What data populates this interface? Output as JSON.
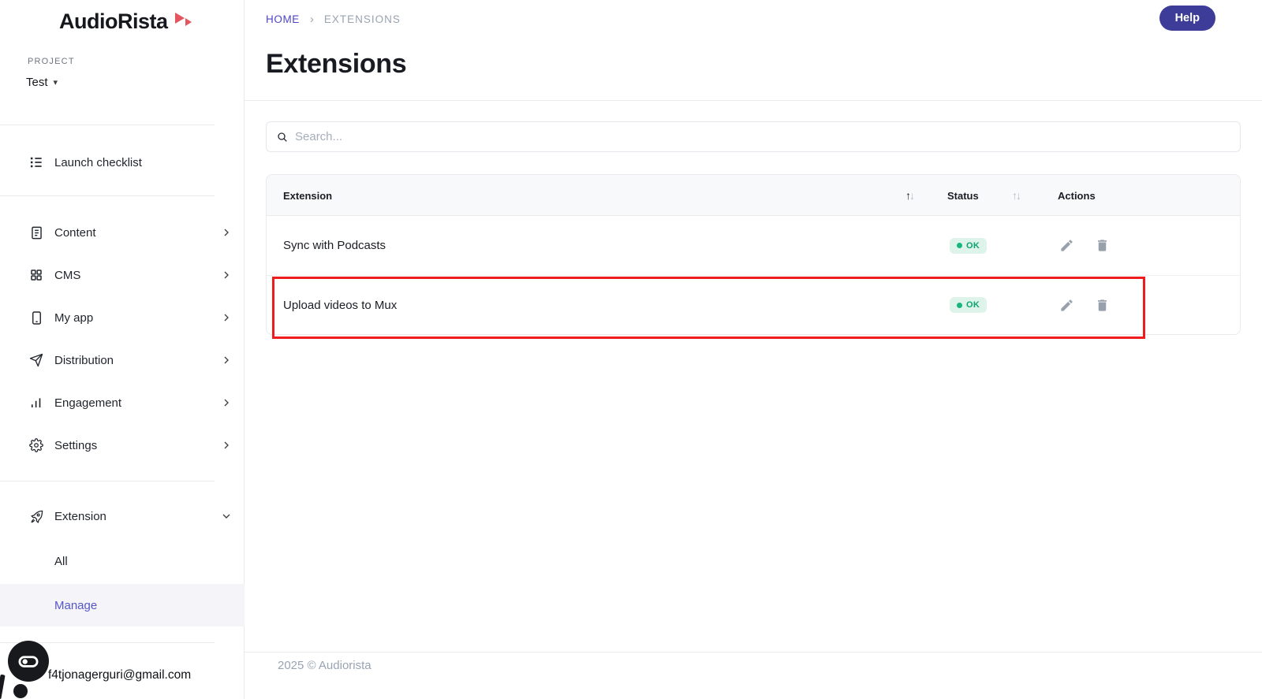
{
  "sidebar": {
    "logo_text": "AudioRista",
    "project_label": "PROJECT",
    "project_value": "Test",
    "launch_checklist": {
      "label": "Launch checklist"
    },
    "menu": [
      {
        "label": "Content",
        "icon": "document-icon"
      },
      {
        "label": "CMS",
        "icon": "grid-icon"
      },
      {
        "label": "My app",
        "icon": "smartphone-icon"
      },
      {
        "label": "Distribution",
        "icon": "send-icon"
      },
      {
        "label": "Engagement",
        "icon": "bar-chart-icon"
      },
      {
        "label": "Settings",
        "icon": "gear-icon"
      }
    ],
    "extension_group": {
      "label": "Extension",
      "children": [
        {
          "label": "All",
          "active": false
        },
        {
          "label": "Manage",
          "active": true
        }
      ]
    },
    "user_email": "f4tjonagerguri@gmail.com"
  },
  "header": {
    "breadcrumb": [
      "HOME",
      "EXTENSIONS"
    ],
    "help_label": "Help",
    "title": "Extensions"
  },
  "search": {
    "placeholder": "Search..."
  },
  "table": {
    "columns": [
      "Extension",
      "Status",
      "Actions"
    ],
    "rows": [
      {
        "name": "Sync with Podcasts",
        "status": "OK",
        "highlighted": false
      },
      {
        "name": "Upload videos to Mux",
        "status": "OK",
        "highlighted": true
      }
    ]
  },
  "footer": {
    "copyright": "2025 © Audiorista"
  },
  "icons": {
    "sort_up": "↑",
    "sort_down": "↓",
    "breadcrumb_separator": "›",
    "caret_down": "▾"
  },
  "colors": {
    "accent_link": "#4d43cb",
    "active_menu": "#5656c8",
    "help_button_bg": "#3d3d99",
    "status_ok_text": "#0ea371",
    "status_ok_bg": "#def4ea",
    "status_ok_dot": "#17b67f",
    "annotation_red": "#ee1c1c",
    "logo_triangle": "#e4555e"
  }
}
